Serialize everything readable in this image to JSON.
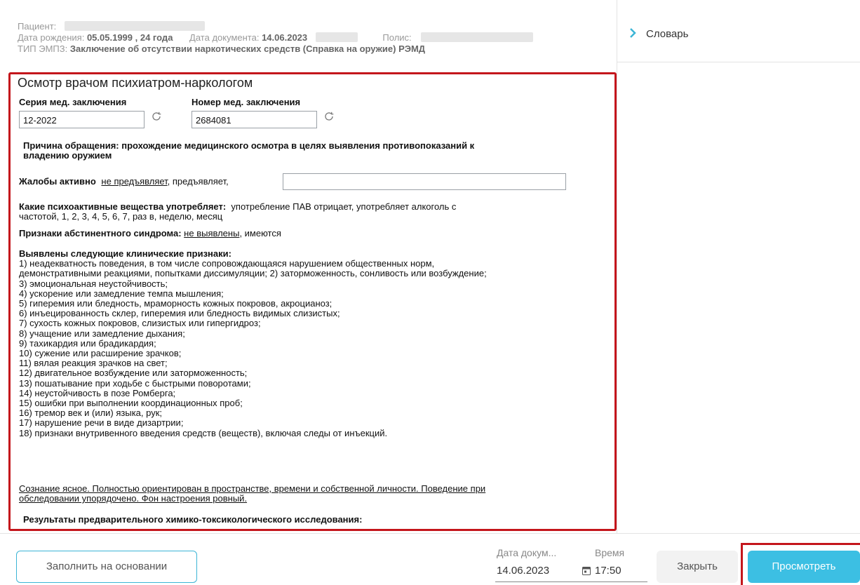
{
  "header": {
    "patient_label": "Пациент:",
    "birth_label": "Дата рождения:",
    "birth_value": "05.05.1999 , 24 года",
    "doc_date_label": "Дата документа:",
    "doc_date_value": "14.06.2023",
    "policy_label": "Полис:",
    "type_label": "ТИП ЭМПЗ:",
    "type_value": "Заключение об отсутствии наркотических средств (Справка на оружие) РЭМД"
  },
  "sidebar": {
    "dictionary_label": "Словарь"
  },
  "form": {
    "title": "Осмотр врачом психиатром-наркологом",
    "series_label": "Серия мед. заключения",
    "series_value": "12-2022",
    "number_label": "Номер мед. заключения",
    "number_value": "2684081",
    "reason": "Причина обращения: прохождение медицинского осмотра в целях выявления противопоказаний к",
    "reason_line2": "владению оружием",
    "complaints_label": "Жалобы активно",
    "complaints_opt1": "не предъявляет",
    "complaints_opt2": ", предъявляет,",
    "complaints_value": "",
    "substances_label": "Какие психоактивные вещества употребляет:",
    "substances_text1": "употребление ПАВ отрицает, употребляет алкоголь с",
    "substances_text2": "частотой, 1, 2, 3, 4, 5, 6, 7, раз в, неделю, месяц",
    "abstinence_label": "Признаки абстинентного синдрома:",
    "abstinence_opt1": "не выявлены",
    "abstinence_opt2": ", имеются",
    "clinical_title": "Выявлены следующие клинические признаки:",
    "clinical_lines": [
      "1) неадекватность поведения, в том числе сопровождающаяся нарушением общественных норм,",
      "демонстративными реакциями, попытками диссимуляции; 2) заторможенность, сонливость или возбуждение;",
      "3) эмоциональная неустойчивость;",
      "4) ускорение или замедление темпа мышления;",
      "5) гиперемия или бледность, мраморность кожных покровов, акроцианоз;",
      "6) инъецированность склер, гиперемия или бледность видимых слизистых;",
      "7) сухость кожных покровов, слизистых или гипергидроз;",
      "8) учащение или замедление дыхания;",
      "9) тахикардия или брадикардия;",
      "10) сужение или расширение зрачков;",
      "11) вялая реакция зрачков на свет;",
      "12) двигательное возбуждение или заторможенность;",
      "13) пошатывание при ходьбе с быстрыми поворотами;",
      "14) неустойчивость в позе Ромберга;",
      "15) ошибки при выполнении координационных проб;",
      "16) тремор век и (или) языка, рук;",
      "17) нарушение речи в виде дизартрии;",
      "18) признаки внутривенного введения средств (веществ), включая следы от инъекций."
    ],
    "consciousness_line1": "Сознание ясное. Полностью ориентирован в пространстве, времени и собственной личности. Поведение при",
    "consciousness_line2": "обследовании упорядочено. Фон настроения ровный.",
    "results_label": "Результаты предварительного химико-токсикологического исследования:"
  },
  "footer": {
    "fill_button": "Заполнить на основании",
    "date_label": "Дата докум...",
    "time_label": "Время",
    "date_value": "14.06.2023",
    "time_value": "17:50",
    "close_button": "Закрыть",
    "view_button": "Просмотреть"
  },
  "colors": {
    "accent": "#3cbfe3",
    "highlight": "#c4161c"
  }
}
